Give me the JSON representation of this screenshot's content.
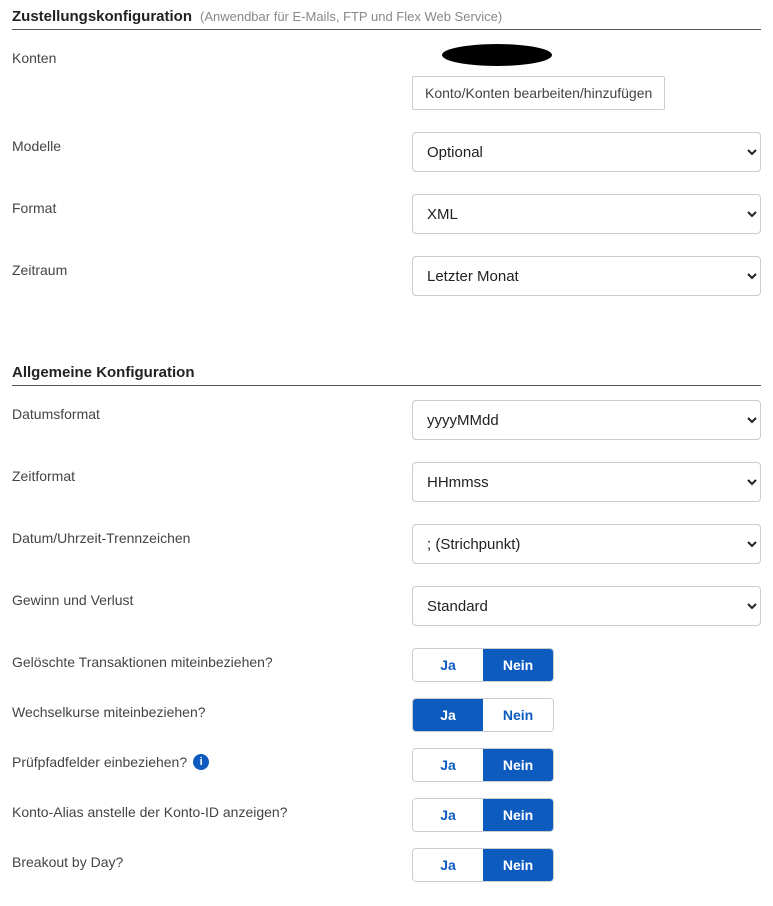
{
  "delivery": {
    "title": "Zustellungskonfiguration",
    "subtitle": "(Anwendbar für E-Mails, FTP und Flex Web Service)",
    "accounts": {
      "label": "Konten",
      "button": "Konto/Konten bearbeiten/hinzufügen"
    },
    "models": {
      "label": "Modelle",
      "value": "Optional"
    },
    "format": {
      "label": "Format",
      "value": "XML"
    },
    "period": {
      "label": "Zeitraum",
      "value": "Letzter Monat"
    }
  },
  "general": {
    "title": "Allgemeine Konfiguration",
    "date_format": {
      "label": "Datumsformat",
      "value": "yyyyMMdd"
    },
    "time_format": {
      "label": "Zeitformat",
      "value": "HHmmss"
    },
    "datetime_sep": {
      "label": "Datum/Uhrzeit-Trennzeichen",
      "value": "; (Strichpunkt)"
    },
    "pnl": {
      "label": "Gewinn und Verlust",
      "value": "Standard"
    },
    "toggle_labels": {
      "yes": "Ja",
      "no": "Nein"
    },
    "deleted_tx": {
      "label": "Gelöschte Transaktionen miteinbeziehen?",
      "value": "Nein"
    },
    "fx_rates": {
      "label": "Wechselkurse miteinbeziehen?",
      "value": "Ja"
    },
    "audit_fields": {
      "label": "Prüfpfadfelder einbeziehen?",
      "value": "Nein"
    },
    "account_alias": {
      "label": "Konto-Alias anstelle der Konto-ID anzeigen?",
      "value": "Nein"
    },
    "breakout_day": {
      "label": "Breakout by Day?",
      "value": "Nein"
    }
  }
}
